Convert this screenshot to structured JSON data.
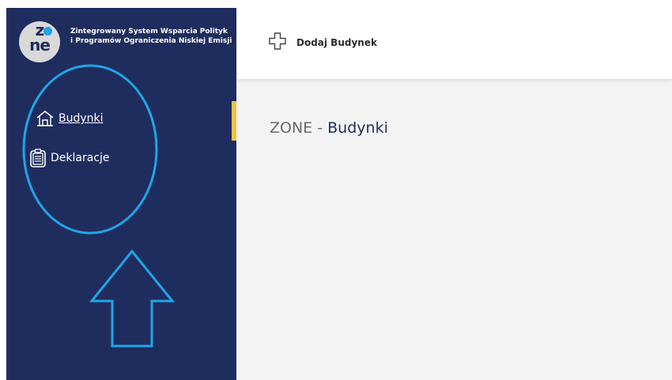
{
  "app": {
    "logo_text_top": "z",
    "logo_text_bottom": "ne",
    "title": "Zintegrowany System Wsparcia Polityk i Programów Ograniczenia Niskiej Emisji"
  },
  "sidebar": {
    "items": [
      {
        "label": "Budynki",
        "icon": "house-icon",
        "active": true
      },
      {
        "label": "Deklaracje",
        "icon": "clipboard-icon",
        "active": false
      }
    ]
  },
  "toolbar": {
    "add_building_label": "Dodaj Budynek",
    "add_icon": "plus-outline-icon"
  },
  "page": {
    "title_prefix": "ZONE",
    "title_separator": " - ",
    "title_section": "Budynki"
  },
  "colors": {
    "sidebar_bg": "#1f2d5e",
    "accent": "#f5c141",
    "annotation": "#1fa6e6",
    "content_bg": "#f3f3f3"
  }
}
